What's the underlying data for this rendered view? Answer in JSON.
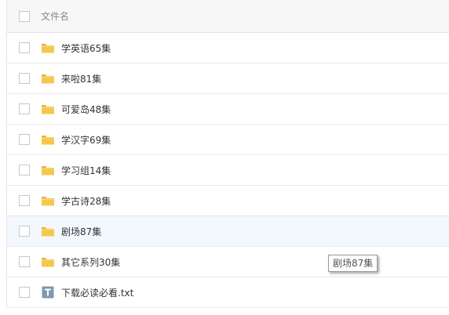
{
  "header": {
    "label": "文件名"
  },
  "files": [
    {
      "name": "学英语65集",
      "type": "folder"
    },
    {
      "name": "来啦81集",
      "type": "folder"
    },
    {
      "name": "可爱岛48集",
      "type": "folder"
    },
    {
      "name": "学汉字69集",
      "type": "folder"
    },
    {
      "name": "学习组14集",
      "type": "folder"
    },
    {
      "name": "学古诗28集",
      "type": "folder"
    },
    {
      "name": "剧场87集",
      "type": "folder"
    },
    {
      "name": "其它系列30集",
      "type": "folder"
    },
    {
      "name": "下载必读必看.txt",
      "type": "txt"
    }
  ],
  "tooltip": {
    "text": "剧场87集"
  },
  "colors": {
    "folder_fill": "#f5c84c",
    "folder_tab": "#e9b23a",
    "txt_icon": "#7e98ad",
    "hover_row": "#f2f8fe"
  }
}
